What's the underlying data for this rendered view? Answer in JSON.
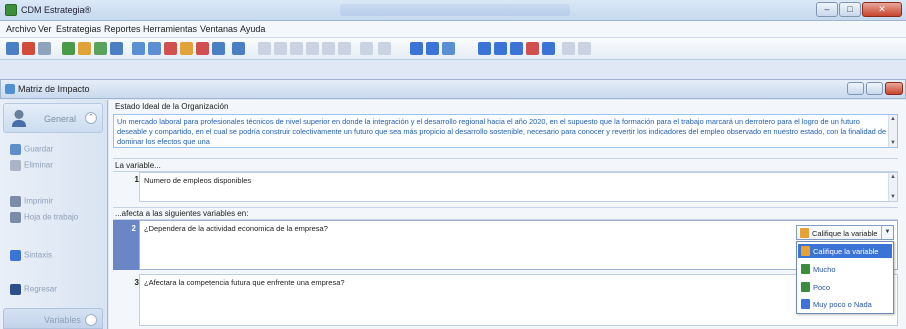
{
  "window": {
    "app_title": "CDM Estrategia®",
    "min_label": "–",
    "max_label": "□",
    "close_label": "✕"
  },
  "menu": [
    "Archivo",
    "Ver",
    "Estrategias",
    "Reportes",
    "Herramientas",
    "Ventanas",
    "Ayuda"
  ],
  "mdi": {
    "title": "Matriz de Impacto"
  },
  "sidebar": {
    "header_label": "General",
    "items": [
      "Guardar",
      "Eliminar",
      "Imprimir",
      "Hoja de trabajo",
      "Sintaxis",
      "Regresar"
    ],
    "footer_label": "Variables"
  },
  "main": {
    "estado_label": "Estado Ideal de la Organización",
    "estado_text": "Un mercado laboral para profesionales técnicos de nivel superior en donde la integración y el desarrollo regional hacia el año 2020, en el supuesto que la formación para el trabajo marcará un derrotero para el logro de un futuro deseable y compartido, en el cual se podría construir colectivamente un futuro que sea más propicio al desarrollo sostenible, necesario para conocer y revertir los indicadores del empleo observado en nuestro estado, con la finalidad de dominar los efectos que una",
    "variable_label": "La variable...",
    "variable_num": "1",
    "variable_text": "Numero de empleos disponibles",
    "afecta_label": "...afecta a las siguientes variables en:",
    "rows": [
      {
        "num": "2",
        "text": "¿Dependera de la actividad economica de la empresa?"
      },
      {
        "num": "3",
        "text": "¿Afectara la competencia futura que enfrente una empresa?"
      }
    ]
  },
  "rating": {
    "selected": "Califique la variable",
    "options": [
      "Califique la variable",
      "Mucho",
      "Poco",
      "Muy poco o Nada"
    ],
    "colors": {
      "header": "#e8a233",
      "mucho": "#3a8d3a",
      "poco": "#3a8d3a",
      "nada": "#3b73d6"
    }
  }
}
